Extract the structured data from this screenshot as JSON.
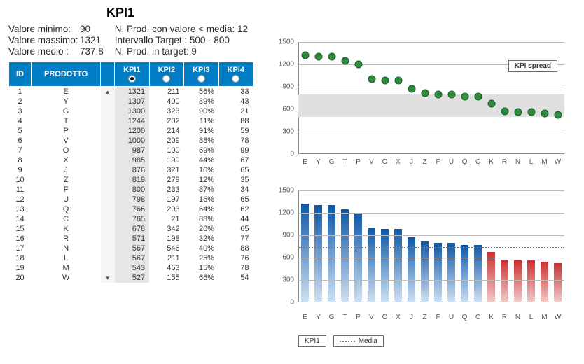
{
  "header": {
    "title": "KPI1",
    "stats_left": [
      {
        "label": "Valore minimo:",
        "value": "90"
      },
      {
        "label": "Valore massimo:",
        "value": "1321"
      },
      {
        "label": "Valore medio :",
        "value": "737,8"
      }
    ],
    "stats_right": [
      "N. Prod. con valore < media: 12",
      "Intervallo Target : 500 - 800",
      "N. Prod. in target:  9"
    ]
  },
  "table": {
    "headers": [
      "ID",
      "PRODOTTO",
      "",
      "KPI1",
      "KPI2",
      "KPI3",
      "KPI4"
    ],
    "selected_kpi": 0,
    "rows": [
      {
        "id": 1,
        "p": "E",
        "k1": 1321,
        "k2": 211,
        "k3": "56%",
        "k4": 33
      },
      {
        "id": 2,
        "p": "Y",
        "k1": 1307,
        "k2": 400,
        "k3": "89%",
        "k4": 43
      },
      {
        "id": 3,
        "p": "G",
        "k1": 1300,
        "k2": 323,
        "k3": "90%",
        "k4": 21
      },
      {
        "id": 4,
        "p": "T",
        "k1": 1244,
        "k2": 202,
        "k3": "11%",
        "k4": 88
      },
      {
        "id": 5,
        "p": "P",
        "k1": 1200,
        "k2": 214,
        "k3": "91%",
        "k4": 59
      },
      {
        "id": 6,
        "p": "V",
        "k1": 1000,
        "k2": 209,
        "k3": "88%",
        "k4": 78
      },
      {
        "id": 7,
        "p": "O",
        "k1": 987,
        "k2": 100,
        "k3": "69%",
        "k4": 99
      },
      {
        "id": 8,
        "p": "X",
        "k1": 985,
        "k2": 199,
        "k3": "44%",
        "k4": 67
      },
      {
        "id": 9,
        "p": "J",
        "k1": 876,
        "k2": 321,
        "k3": "10%",
        "k4": 65
      },
      {
        "id": 10,
        "p": "Z",
        "k1": 819,
        "k2": 279,
        "k3": "12%",
        "k4": 35
      },
      {
        "id": 11,
        "p": "F",
        "k1": 800,
        "k2": 233,
        "k3": "87%",
        "k4": 34
      },
      {
        "id": 12,
        "p": "U",
        "k1": 798,
        "k2": 197,
        "k3": "16%",
        "k4": 65
      },
      {
        "id": 13,
        "p": "Q",
        "k1": 766,
        "k2": 203,
        "k3": "64%",
        "k4": 62
      },
      {
        "id": 14,
        "p": "C",
        "k1": 765,
        "k2": 21,
        "k3": "88%",
        "k4": 44
      },
      {
        "id": 15,
        "p": "K",
        "k1": 678,
        "k2": 342,
        "k3": "20%",
        "k4": 65
      },
      {
        "id": 16,
        "p": "R",
        "k1": 571,
        "k2": 198,
        "k3": "32%",
        "k4": 77
      },
      {
        "id": 17,
        "p": "N",
        "k1": 567,
        "k2": 546,
        "k3": "40%",
        "k4": 88
      },
      {
        "id": 18,
        "p": "L",
        "k1": 567,
        "k2": 211,
        "k3": "25%",
        "k4": 76
      },
      {
        "id": 19,
        "p": "M",
        "k1": 543,
        "k2": 453,
        "k3": "15%",
        "k4": 78
      },
      {
        "id": 20,
        "p": "W",
        "k1": 527,
        "k2": 155,
        "k3": "66%",
        "k4": 54
      }
    ]
  },
  "chart_data": [
    {
      "type": "scatter",
      "title": "KPI spread",
      "target_band": [
        500,
        800
      ],
      "ylim": [
        0,
        1500
      ],
      "yticks": [
        0,
        300,
        600,
        900,
        1200,
        1500
      ],
      "categories": [
        "E",
        "Y",
        "G",
        "T",
        "P",
        "V",
        "O",
        "X",
        "J",
        "Z",
        "F",
        "U",
        "Q",
        "C",
        "K",
        "R",
        "N",
        "L",
        "M",
        "W"
      ],
      "values": [
        1321,
        1307,
        1300,
        1244,
        1200,
        1000,
        987,
        985,
        876,
        819,
        800,
        798,
        766,
        765,
        678,
        571,
        567,
        567,
        543,
        527
      ]
    },
    {
      "type": "bar",
      "media": 737.8,
      "ylim": [
        0,
        1500
      ],
      "yticks": [
        0,
        300,
        600,
        900,
        1200,
        1500
      ],
      "categories": [
        "E",
        "Y",
        "G",
        "T",
        "P",
        "V",
        "O",
        "X",
        "J",
        "Z",
        "F",
        "U",
        "Q",
        "C",
        "K",
        "R",
        "N",
        "L",
        "M",
        "W"
      ],
      "values": [
        1321,
        1307,
        1300,
        1244,
        1200,
        1000,
        987,
        985,
        876,
        819,
        800,
        798,
        766,
        765,
        678,
        571,
        567,
        567,
        543,
        527
      ],
      "legend": [
        "KPI1",
        "Media"
      ]
    }
  ]
}
